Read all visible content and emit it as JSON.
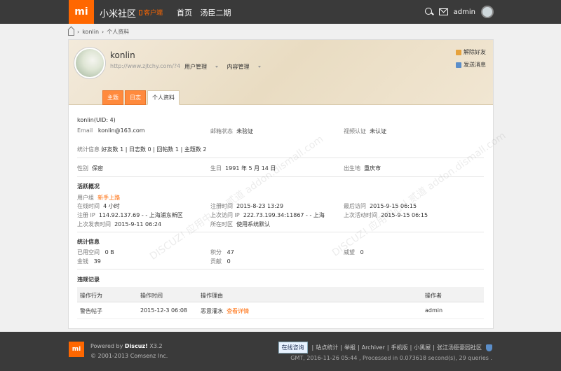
{
  "header": {
    "logo_text": "mi",
    "site_name": "小米社区",
    "client_tag": "客户端",
    "nav": [
      "首页",
      "汤臣二期"
    ],
    "username": "admin"
  },
  "breadcrumb": {
    "user": "konlin",
    "page": "个人资料"
  },
  "profile": {
    "name": "konlin",
    "url": "http://www.zjtchy.com/?4",
    "menu": [
      "用户管理",
      "内容管理"
    ],
    "actions": [
      "解除好友",
      "发送消息"
    ],
    "tabs": [
      "主题",
      "日志",
      "个人资料"
    ]
  },
  "info": {
    "uid_line": "konlin(UID: 4)",
    "email_label": "Email",
    "email": "konlin@163.com",
    "mail_status_label": "邮箱状态",
    "mail_status": "未验证",
    "video_label": "视频认证",
    "video_status": "未认证",
    "stats_label": "统计信息",
    "stats": [
      "好友数 1",
      "日志数 0",
      "回帖数 1",
      "主题数 2"
    ],
    "gender_label": "性别",
    "gender": "保密",
    "birthday_label": "生日",
    "birthday": "1991 年 5 月 14 日",
    "birthplace_label": "出生地",
    "birthplace": "重庆市"
  },
  "activity": {
    "title": "活跃概况",
    "group_label": "用户组",
    "group": "新手上路",
    "online_label": "在线时间",
    "online": "4 小时",
    "reg_time_label": "注册时间",
    "reg_time": "2015-8-23 13:29",
    "last_visit_label": "最后访问",
    "last_visit": "2015-9-15 06:15",
    "reg_ip_label": "注册 IP",
    "reg_ip": "114.92.137.69 - - 上海浦东新区",
    "last_ip_label": "上次访问 IP",
    "last_ip": "222.73.199.34:11867 - - 上海",
    "last_active_label": "上次活动时间",
    "last_active": "2015-9-15 06:15",
    "last_post_label": "上次发表时间",
    "last_post": "2015-9-11 06:24",
    "timezone_label": "所在时区",
    "timezone": "使用系统默认"
  },
  "stats": {
    "title": "统计信息",
    "space_label": "已用空间",
    "space": "0 B",
    "points_label": "积分",
    "points": "47",
    "prestige_label": "威望",
    "prestige": "0",
    "money_label": "金钱",
    "money": "39",
    "contrib_label": "贡献",
    "contrib": "0"
  },
  "violations": {
    "title": "违规记录",
    "headers": [
      "操作行为",
      "操作时间",
      "操作理由",
      "操作者"
    ],
    "rows": [
      {
        "action": "警告帖子",
        "time": "2015-12-3 06:08",
        "reason": "恶意灌水",
        "link": "查看详情",
        "operator": "admin"
      }
    ]
  },
  "footer": {
    "logo_text": "mi",
    "powered_prefix": "Powered by",
    "powered_brand": "Discuz!",
    "powered_version": "X3.2",
    "copyright": "© 2001-2013 Comsenz Inc.",
    "online_btn": "在线咨询",
    "links": [
      "站点统计",
      "举报",
      "Archiver",
      "手机版",
      "小黑屋",
      "张江汤臣豪园社区"
    ],
    "stat_line": "GMT, 2016-11-26 05:44 , Processed in 0.073618 second(s), 29 queries ."
  },
  "watermark": "DISCUZ! 应用中心 | 贰道 addon.dismall.com"
}
